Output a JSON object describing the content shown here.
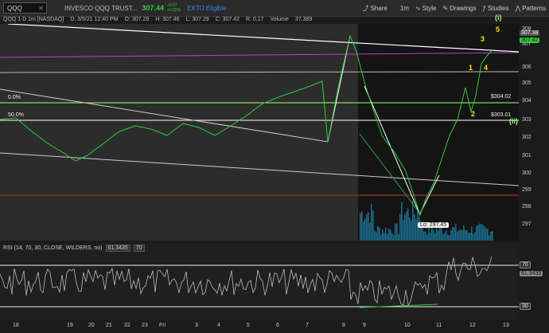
{
  "toolbar": {
    "symbol": "QQQ",
    "instrument_name": "INVESCO QQQ TRUST...",
    "last_price": "307.44",
    "change_top": "+0.07",
    "change_bottom": "+0.02%",
    "exto_label": "EXTO Eligible",
    "share_label": "Share",
    "interval_label": "1m",
    "style_label": "Style",
    "drawings_label": "Drawings",
    "studies_label": "Studies",
    "patterns_label": "Patterns"
  },
  "ohlc": {
    "title": "QQQ 1 D 1m [NASDAQ]",
    "date": "D: 3/5/21 12:40 PM",
    "open": "O: 307.29",
    "high": "H: 307.46",
    "low": "L: 307.29",
    "close": "C: 307.42",
    "range": "R: 0.17",
    "volume_label": "Volume",
    "volume": "37,389"
  },
  "price_axis": {
    "ticks": [
      "308",
      "307",
      "306",
      "305",
      "304",
      "303",
      "302",
      "301",
      "300",
      "299",
      "298",
      "297"
    ],
    "last_tag": "307.42",
    "prev_tag": "307.38"
  },
  "annotations": {
    "fib_0": "0.0%",
    "fib_50": "50.0%",
    "level_304": "$304.02",
    "level_303": "$303.01",
    "low_label": "Lo: 297.45",
    "wave_i": "(i)",
    "wave_ii": "(ii)",
    "wave_1": "1",
    "wave_2": "2",
    "wave_3": "3",
    "wave_4": "4",
    "wave_5": "5"
  },
  "rsi": {
    "label": "RSI (14, 70, 30, CLOSE, WILDERS, no)",
    "value": "61.3435",
    "overbought": "70",
    "oversold": "30",
    "tag_value": "61.3435",
    "tag_70": "70",
    "tag_30": "30"
  },
  "time_axis": {
    "ticks": [
      "18",
      "19",
      "20",
      "21",
      "22",
      "23",
      "Fri",
      "3",
      "4",
      "5",
      "6",
      "7",
      "8",
      "9",
      "10",
      "11",
      "12",
      "13"
    ]
  },
  "colors": {
    "up": "#2ecc40",
    "down": "#ff3b3b",
    "wave": "#f7e300",
    "fib_line": "#a4ff6e",
    "purple": "#c040c0",
    "volume": "#1b6a8a"
  }
}
